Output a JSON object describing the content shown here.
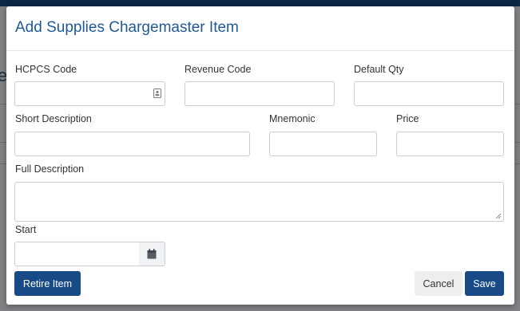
{
  "modal": {
    "title": "Add Supplies Chargemaster Item"
  },
  "form": {
    "hcpcs_code": {
      "label": "HCPCS Code",
      "value": ""
    },
    "revenue_code": {
      "label": "Revenue Code",
      "value": ""
    },
    "default_qty": {
      "label": "Default Qty",
      "value": ""
    },
    "short_description": {
      "label": "Short Description",
      "value": ""
    },
    "mnemonic": {
      "label": "Mnemonic",
      "value": ""
    },
    "price": {
      "label": "Price",
      "value": ""
    },
    "full_description": {
      "label": "Full Description",
      "value": ""
    },
    "start": {
      "label": "Start",
      "value": ""
    }
  },
  "buttons": {
    "retire": "Retire Item",
    "cancel": "Cancel",
    "save": "Save"
  },
  "icons": {
    "hcpcs_picker": "contact-card-icon",
    "date_picker": "calendar-icon",
    "textarea_resize": "resize-grip-icon"
  },
  "colors": {
    "primary": "#174a86",
    "title": "#1f5a97",
    "backdrop": "#808285",
    "top_bar": "#0b2647"
  }
}
